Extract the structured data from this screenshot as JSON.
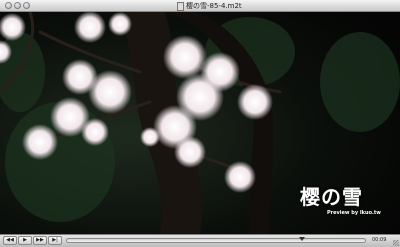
{
  "window": {
    "title": "樱の雪-85-4.m2t"
  },
  "video": {
    "overlay_title": "樱の雪",
    "overlay_credit": "Preview by Ikuo.tw"
  },
  "controls": {
    "rewind_icon": "rewind-icon",
    "play_icon": "play-icon",
    "forward_icon": "fast-forward-icon",
    "end_icon": "skip-to-end-icon",
    "playback_progress": 0.79,
    "timecode": "00:09"
  }
}
